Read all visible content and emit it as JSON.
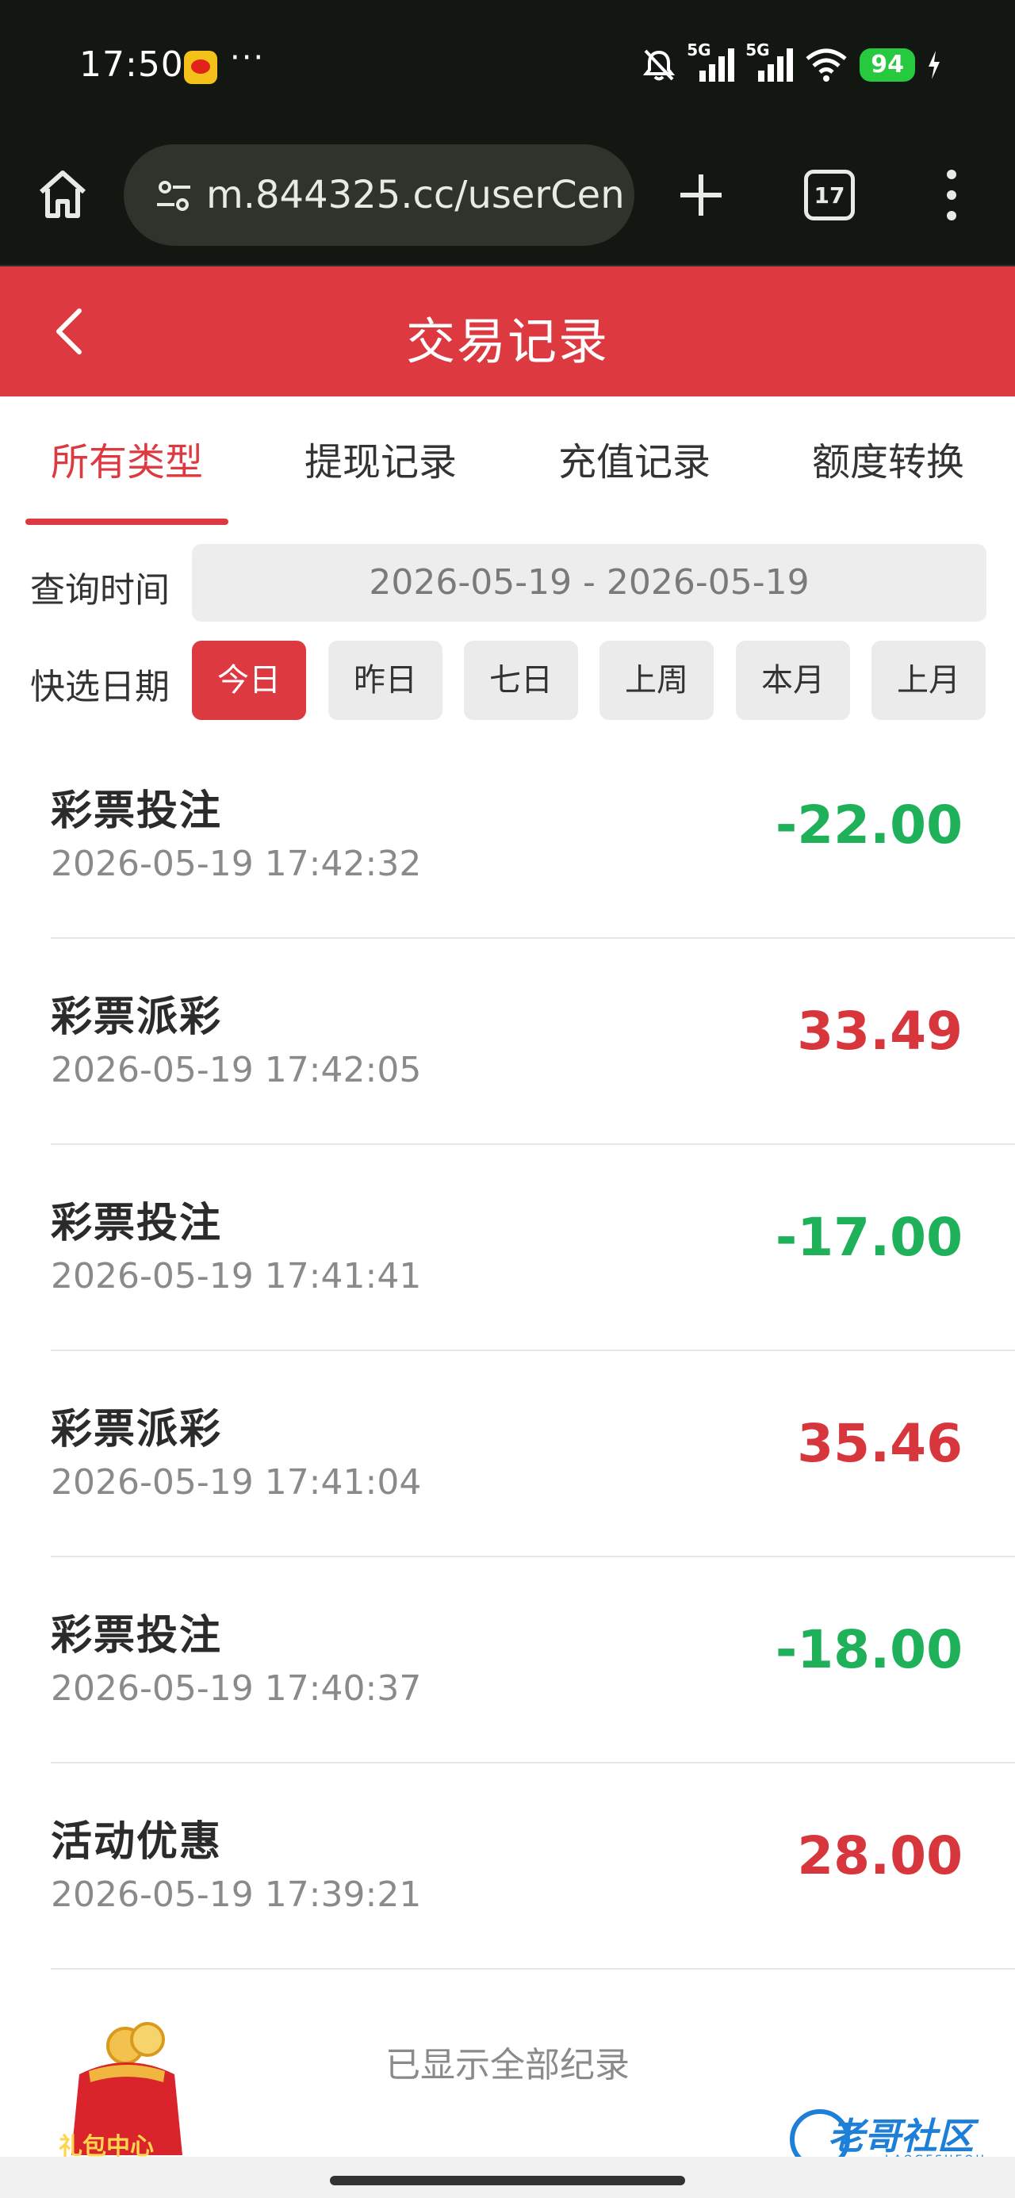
{
  "status_bar": {
    "time": "17:50",
    "more": "···",
    "network1": "5G",
    "network2": "5G",
    "battery": "94",
    "icons": [
      "weibo-icon",
      "bell-off-icon",
      "signal-icon",
      "signal-icon",
      "wifi-icon",
      "charging-icon"
    ]
  },
  "browser": {
    "url": "m.844325.cc/userCen",
    "tab_count": "17",
    "icons": [
      "home-icon",
      "site-settings-icon",
      "plus-icon",
      "tabs-icon",
      "more-vert-icon"
    ]
  },
  "header": {
    "title": "交易记录",
    "back_icon": "chevron-left-icon"
  },
  "tabs": [
    {
      "label": "所有类型",
      "active": true
    },
    {
      "label": "提现记录",
      "active": false
    },
    {
      "label": "充值记录",
      "active": false
    },
    {
      "label": "额度转换",
      "active": false
    }
  ],
  "query": {
    "time_label": "查询时间",
    "date_range": "2026-05-19 - 2026-05-19",
    "quick_label": "快选日期",
    "quick_options": [
      {
        "label": "今日",
        "active": true
      },
      {
        "label": "昨日",
        "active": false
      },
      {
        "label": "七日",
        "active": false
      },
      {
        "label": "上周",
        "active": false
      },
      {
        "label": "本月",
        "active": false
      },
      {
        "label": "上月",
        "active": false
      }
    ]
  },
  "records": [
    {
      "type": "彩票投注",
      "time": "2026-05-19 17:42:32",
      "amount": "-22.00",
      "sign": "negative"
    },
    {
      "type": "彩票派彩",
      "time": "2026-05-19 17:42:05",
      "amount": "33.49",
      "sign": "positive"
    },
    {
      "type": "彩票投注",
      "time": "2026-05-19 17:41:41",
      "amount": "-17.00",
      "sign": "negative"
    },
    {
      "type": "彩票派彩",
      "time": "2026-05-19 17:41:04",
      "amount": "35.46",
      "sign": "positive"
    },
    {
      "type": "彩票投注",
      "time": "2026-05-19 17:40:37",
      "amount": "-18.00",
      "sign": "negative"
    },
    {
      "type": "活动优惠",
      "time": "2026-05-19 17:39:21",
      "amount": "28.00",
      "sign": "positive"
    }
  ],
  "footer": {
    "end_text": "已显示全部纪录",
    "gift_label": "礼包中心",
    "watermark": "老哥社区",
    "watermark_sub": "LAOGESHEQU"
  },
  "colors": {
    "brand_red": "#dc3a40",
    "negative_green": "#1fb05a",
    "positive_red": "#d8363d",
    "dark_chrome": "#131712"
  }
}
